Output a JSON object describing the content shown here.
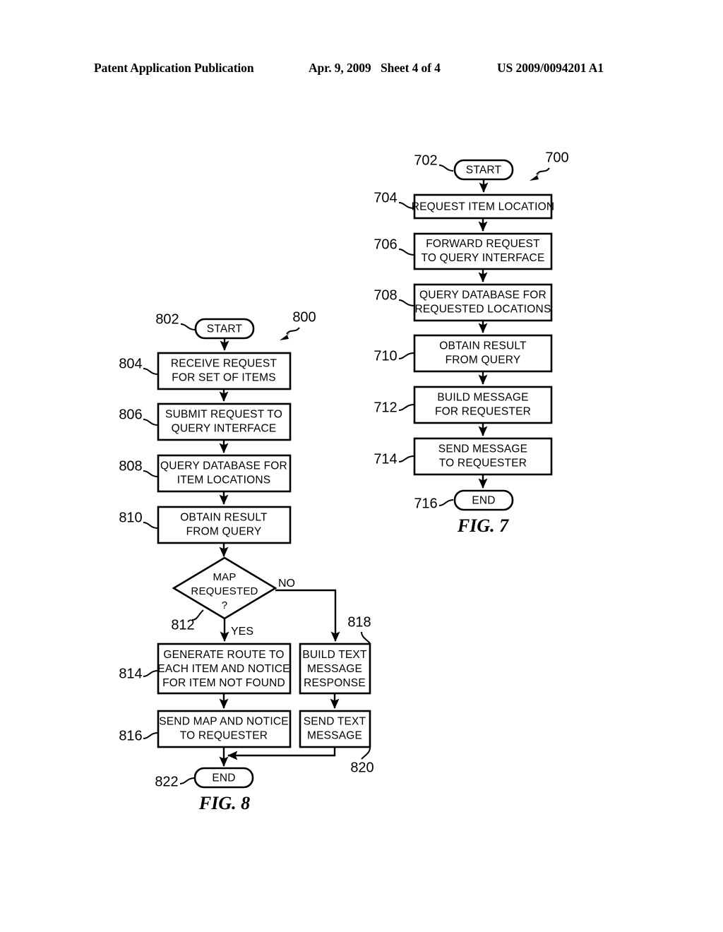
{
  "header": {
    "publication": "Patent Application Publication",
    "date": "Apr. 9, 2009",
    "sheet": "Sheet 4 of 4",
    "patent_number": "US 2009/0094201 A1"
  },
  "figures": [
    {
      "caption": "FIG. 7",
      "figure_ref": "700",
      "nodes": [
        {
          "ref": "702",
          "type": "terminator",
          "lines": [
            "START"
          ]
        },
        {
          "ref": "704",
          "type": "process",
          "lines": [
            "REQUEST ITEM LOCATION"
          ]
        },
        {
          "ref": "706",
          "type": "process",
          "lines": [
            "FORWARD REQUEST",
            "TO QUERY INTERFACE"
          ]
        },
        {
          "ref": "708",
          "type": "process",
          "lines": [
            "QUERY DATABASE FOR",
            "REQUESTED LOCATIONS"
          ]
        },
        {
          "ref": "710",
          "type": "process",
          "lines": [
            "OBTAIN RESULT",
            "FROM QUERY"
          ]
        },
        {
          "ref": "712",
          "type": "process",
          "lines": [
            "BUILD MESSAGE",
            "FOR REQUESTER"
          ]
        },
        {
          "ref": "714",
          "type": "process",
          "lines": [
            "SEND MESSAGE",
            "TO REQUESTER"
          ]
        },
        {
          "ref": "716",
          "type": "terminator",
          "lines": [
            "END"
          ]
        }
      ]
    },
    {
      "caption": "FIG. 8",
      "figure_ref": "800",
      "nodes": [
        {
          "ref": "802",
          "type": "terminator",
          "lines": [
            "START"
          ]
        },
        {
          "ref": "804",
          "type": "process",
          "lines": [
            "RECEIVE REQUEST",
            "FOR SET OF ITEMS"
          ]
        },
        {
          "ref": "806",
          "type": "process",
          "lines": [
            "SUBMIT REQUEST TO",
            "QUERY INTERFACE"
          ]
        },
        {
          "ref": "808",
          "type": "process",
          "lines": [
            "QUERY DATABASE FOR",
            "ITEM LOCATIONS"
          ]
        },
        {
          "ref": "810",
          "type": "process",
          "lines": [
            "OBTAIN RESULT",
            "FROM QUERY"
          ]
        },
        {
          "ref": "812",
          "type": "decision",
          "lines": [
            "MAP",
            "REQUESTED",
            "?"
          ]
        },
        {
          "ref": "814",
          "type": "process",
          "lines": [
            "GENERATE ROUTE TO",
            "EACH ITEM AND NOTICE",
            "FOR ITEM NOT FOUND"
          ]
        },
        {
          "ref": "816",
          "type": "process",
          "lines": [
            "SEND MAP AND NOTICE",
            "TO REQUESTER"
          ]
        },
        {
          "ref": "818",
          "type": "process",
          "lines": [
            "BUILD TEXT",
            "MESSAGE",
            "RESPONSE"
          ]
        },
        {
          "ref": "820",
          "type": "process",
          "lines": [
            "SEND TEXT",
            "MESSAGE"
          ]
        },
        {
          "ref": "822",
          "type": "terminator",
          "lines": [
            "END"
          ]
        }
      ],
      "branch_labels": {
        "yes": "YES",
        "no": "NO"
      }
    }
  ]
}
